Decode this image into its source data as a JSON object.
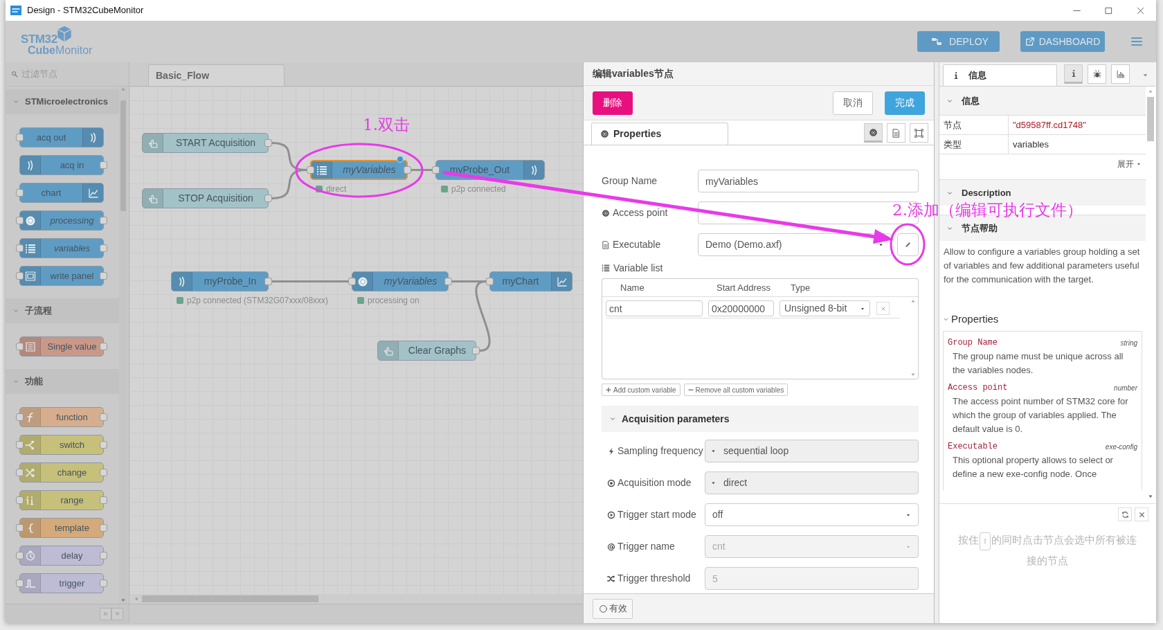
{
  "window": {
    "title": "Design - STM32CubeMonitor"
  },
  "header": {
    "logo": {
      "line1": "STM32",
      "line2": "**Cube**Monitor"
    },
    "buttons": [
      {
        "label": "DEPLOY",
        "kind": "deploy"
      },
      {
        "label": "DASHBOARD",
        "kind": "dashboard"
      }
    ]
  },
  "palette": {
    "filter": {
      "placeholder": "过滤节点"
    },
    "categories": [
      {
        "name": "STMicroelectronics",
        "expanded": true,
        "nodes": [
          {
            "label": "acq out",
            "kind": "acq_out",
            "color": "#5f9cc4"
          },
          {
            "label": "acq in",
            "kind": "acq_in",
            "color": "#5f9cc4"
          },
          {
            "label": "chart",
            "kind": "chart",
            "color": "#5f9cc4"
          },
          {
            "label": "processing",
            "kind": "processing",
            "color": "#5f9cc4"
          },
          {
            "label": "variables",
            "kind": "variables",
            "color": "#5f9cc4"
          },
          {
            "label": "write panel",
            "kind": "write_panel",
            "color": "#5f9cc4"
          }
        ]
      },
      {
        "name": "子流程",
        "expanded": true,
        "nodes": [
          {
            "label": "Single value",
            "kind": "single_value",
            "color": "#c99889"
          }
        ]
      },
      {
        "name": "功能",
        "expanded": true,
        "nodes": [
          {
            "label": "function",
            "kind": "function",
            "color": "#d6ae8e"
          },
          {
            "label": "switch",
            "kind": "switch",
            "color": "#c6c07a"
          },
          {
            "label": "change",
            "kind": "change",
            "color": "#c6c07a"
          },
          {
            "label": "range",
            "kind": "range",
            "color": "#c6c07a"
          },
          {
            "label": "template",
            "kind": "template",
            "color": "#d4aa7a"
          },
          {
            "label": "delay",
            "kind": "delay",
            "color": "#bdbcd4"
          },
          {
            "label": "trigger",
            "kind": "trigger",
            "color": "#bdbcd4"
          }
        ]
      }
    ]
  },
  "workspace": {
    "tabs": [
      {
        "label": "Basic_Flow",
        "selected": true
      }
    ],
    "nodes": [
      {
        "label": "START Acquisition",
        "kind": "inject",
        "color": "#a2c2c7",
        "selected": false,
        "changed": false
      },
      {
        "label": "myVariables",
        "kind": "variables",
        "color": "#5f9cc4",
        "selected": true,
        "changed": true,
        "status": "direct"
      },
      {
        "label": "myProbe_Out",
        "kind": "acq_out",
        "color": "#5f9cc4",
        "selected": false,
        "changed": false,
        "status": "p2p connected"
      },
      {
        "label": "STOP Acquisition",
        "kind": "inject",
        "color": "#a2c2c7",
        "selected": false,
        "changed": false
      },
      {
        "label": "myProbe_In",
        "kind": "acq_in",
        "color": "#5f9cc4",
        "selected": false,
        "changed": false,
        "status": "p2p connected (STM32G07xxx/08xxx)"
      },
      {
        "label": "myVariables",
        "kind": "processing",
        "color": "#5f9cc4",
        "selected": false,
        "changed": false,
        "status": "processing on"
      },
      {
        "label": "myChart",
        "kind": "chart",
        "color": "#5f9cc4",
        "selected": false,
        "changed": false
      },
      {
        "label": "Clear Graphs",
        "kind": "inject",
        "color": "#a2c2c7",
        "selected": false,
        "changed": false
      }
    ]
  },
  "editor": {
    "title": "编辑variables节点",
    "buttons": [
      {
        "label": "删除",
        "kind": "delete"
      },
      {
        "label": "取消",
        "kind": "cancel"
      },
      {
        "label": "完成",
        "kind": "done"
      }
    ],
    "tabs": [
      {
        "label": "Properties",
        "selected": true
      }
    ],
    "view_buttons": [
      {
        "kind": "settings",
        "selected": true
      },
      {
        "kind": "description",
        "selected": false
      },
      {
        "kind": "appearance",
        "selected": false
      }
    ],
    "fields": [
      {
        "label": "Group Name",
        "kind": "text",
        "value": "myVariables"
      },
      {
        "label": "Access point",
        "kind": "text"
      },
      {
        "label": "Executable",
        "kind": "select_edit",
        "value": "Demo (Demo.axf)"
      }
    ],
    "variable_list": {
      "label": "Variable list",
      "columns": [
        "Name",
        "Start Address",
        "Type"
      ],
      "rows": [
        {
          "name": "cnt",
          "address": "0x20000000",
          "type": "Unsigned 8-bit"
        }
      ],
      "buttons": [
        {
          "label": "Add custom variable",
          "kind": "add"
        },
        {
          "label": "Remove all custom variables",
          "kind": "remove"
        }
      ]
    },
    "acquisition": {
      "title": "Acquisition parameters",
      "expanded": true,
      "fields": [
        {
          "label": "Sampling frequency",
          "kind": "typed",
          "value": "sequential loop",
          "disabled": false
        },
        {
          "label": "Acquisition mode",
          "kind": "typed",
          "value": "direct",
          "disabled": false
        },
        {
          "label": "Trigger start mode",
          "kind": "select",
          "value": "off",
          "disabled": false
        },
        {
          "label": "Trigger name",
          "kind": "select",
          "value": "cnt",
          "disabled": true
        },
        {
          "label": "Trigger threshold",
          "kind": "text",
          "value": "5",
          "disabled": true
        }
      ]
    },
    "footer": {
      "toggle": {
        "label": "有效",
        "on": false
      }
    }
  },
  "sidebar": {
    "tabs": [
      {
        "label": "信息",
        "selected": true
      }
    ],
    "icon_tabs": [
      {
        "kind": "info",
        "selected": true
      },
      {
        "kind": "debug",
        "selected": false
      },
      {
        "kind": "chart",
        "selected": false
      }
    ],
    "info": {
      "title": "信息",
      "expanded": true,
      "rows": [
        {
          "key": "节点",
          "value": "\"d59587ff.cd1748\"",
          "kind": "id"
        },
        {
          "key": "类型",
          "value": "variables",
          "kind": "plain"
        }
      ],
      "more": "展开"
    },
    "sections": [
      {
        "title": "Description",
        "expanded": true
      },
      {
        "title": "节点帮助",
        "expanded": true
      }
    ],
    "help": {
      "intro": "Allow to configure a variables group holding a set of variables and few additional parameters useful for the communication with the target.",
      "properties_title": "Properties",
      "properties": [
        {
          "name": "Group Name",
          "type": "string",
          "text": "The group name must be unique across all the variables nodes."
        },
        {
          "name": "Access point",
          "type": "number",
          "text": "The access point number of STM32 core for which the group of variables applied. The default value is 0."
        },
        {
          "name": "Executable",
          "type": "exe-config",
          "text": "This optional property allows to select or define a new exe-config node. Once"
        }
      ]
    },
    "hint": {
      "before": "按住",
      "key": "⇧",
      "after": "的同时点击节点会选中所有被连接的节点"
    }
  },
  "annotations": [
    {
      "text": "1.双击"
    },
    {
      "text": "2.添加（编辑可执行文件）"
    }
  ]
}
